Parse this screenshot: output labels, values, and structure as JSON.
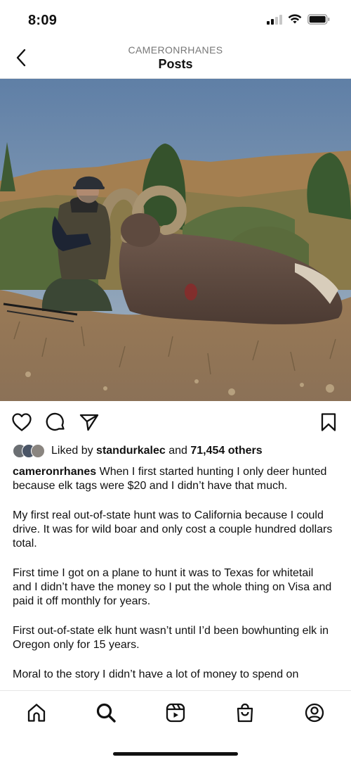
{
  "status_bar": {
    "time": "8:09"
  },
  "header": {
    "username": "CAMERONRHANES",
    "title": "Posts"
  },
  "photo": {
    "alt": ""
  },
  "likes": {
    "prefix": "Liked by ",
    "liker": "standurkalec",
    "connector": " and ",
    "count": "71,454 others"
  },
  "caption": {
    "username": "cameronrhanes",
    "paragraphs": [
      "When I first started hunting I only deer hunted because elk tags were $20 and I didn’t have that much.",
      "My first real out-of-state hunt was to California because I could drive. It was for wild boar and only cost a couple hundred dollars total.",
      "First time I got on a plane to hunt it was to Texas for whitetail and I didn’t have the money so I put the whole thing on Visa and paid it off monthly for years.",
      "First out-of-state elk hunt wasn’t until I’d been bowhunting elk in Oregon only for 15 years.",
      "Moral to the story I didn’t have a lot of money to spend on"
    ]
  },
  "icons": {
    "back": "chevron-left-icon",
    "like": "heart-icon",
    "comment": "comment-icon",
    "share": "send-icon",
    "save": "bookmark-icon",
    "tabs": [
      "home-icon",
      "search-icon",
      "reels-icon",
      "shop-icon",
      "profile-icon"
    ]
  }
}
